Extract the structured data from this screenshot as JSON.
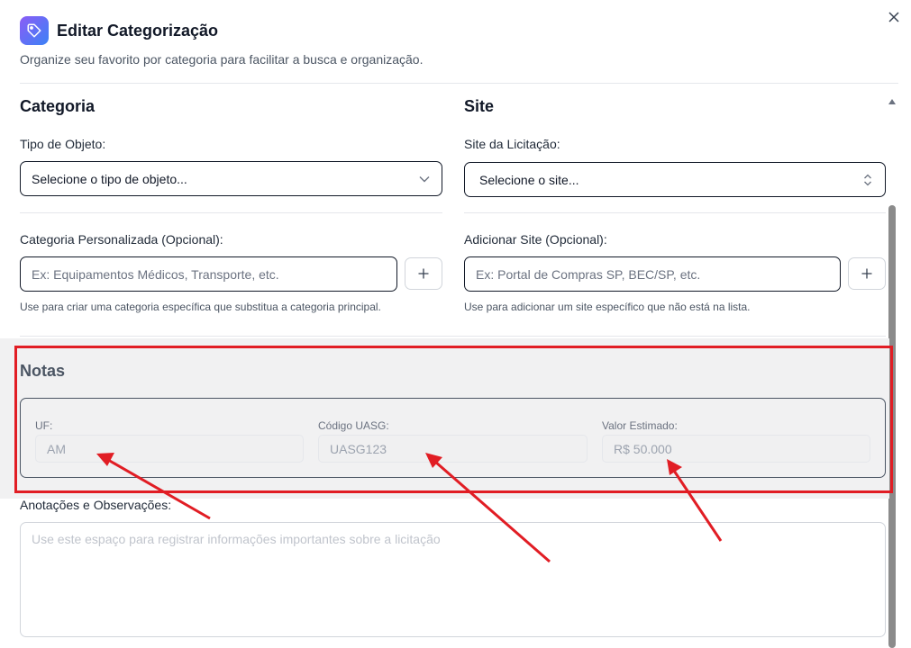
{
  "dialog": {
    "title": "Editar Categorização",
    "subtitle": "Organize seu favorito por categoria para facilitar a busca e organização.",
    "close_icon": "close-icon",
    "title_icon": "tags-icon"
  },
  "categoria": {
    "section_title": "Categoria",
    "tipo_label": "Tipo de Objeto:",
    "tipo_value": "Selecione o tipo de objeto...",
    "custom_label": "Categoria Personalizada (Opcional):",
    "custom_placeholder": "Ex: Equipamentos Médicos, Transporte, etc.",
    "custom_help": "Use para criar uma categoria específica que substitua a categoria principal.",
    "add_button": "+"
  },
  "site": {
    "section_title": "Site",
    "site_label": "Site da Licitação:",
    "site_value": "Selecione o site...",
    "add_label": "Adicionar Site (Opcional):",
    "add_placeholder": "Ex: Portal de Compras SP, BEC/SP, etc.",
    "add_help": "Use para adicionar um site específico que não está na lista.",
    "add_button": "+"
  },
  "notas": {
    "section_title": "Notas",
    "fields": [
      {
        "label": "UF:",
        "value": "AM"
      },
      {
        "label": "Código UASG:",
        "value": "UASG123"
      },
      {
        "label": "Valor Estimado:",
        "value": "R$ 50.000"
      }
    ]
  },
  "anotacoes": {
    "label": "Anotações e Observações:",
    "placeholder": "Use este espaço para registrar informações importantes sobre a licitação"
  },
  "colors": {
    "highlight": "#e11d24",
    "accent_start": "#8b5cf6",
    "accent_end": "#3b82f6"
  }
}
